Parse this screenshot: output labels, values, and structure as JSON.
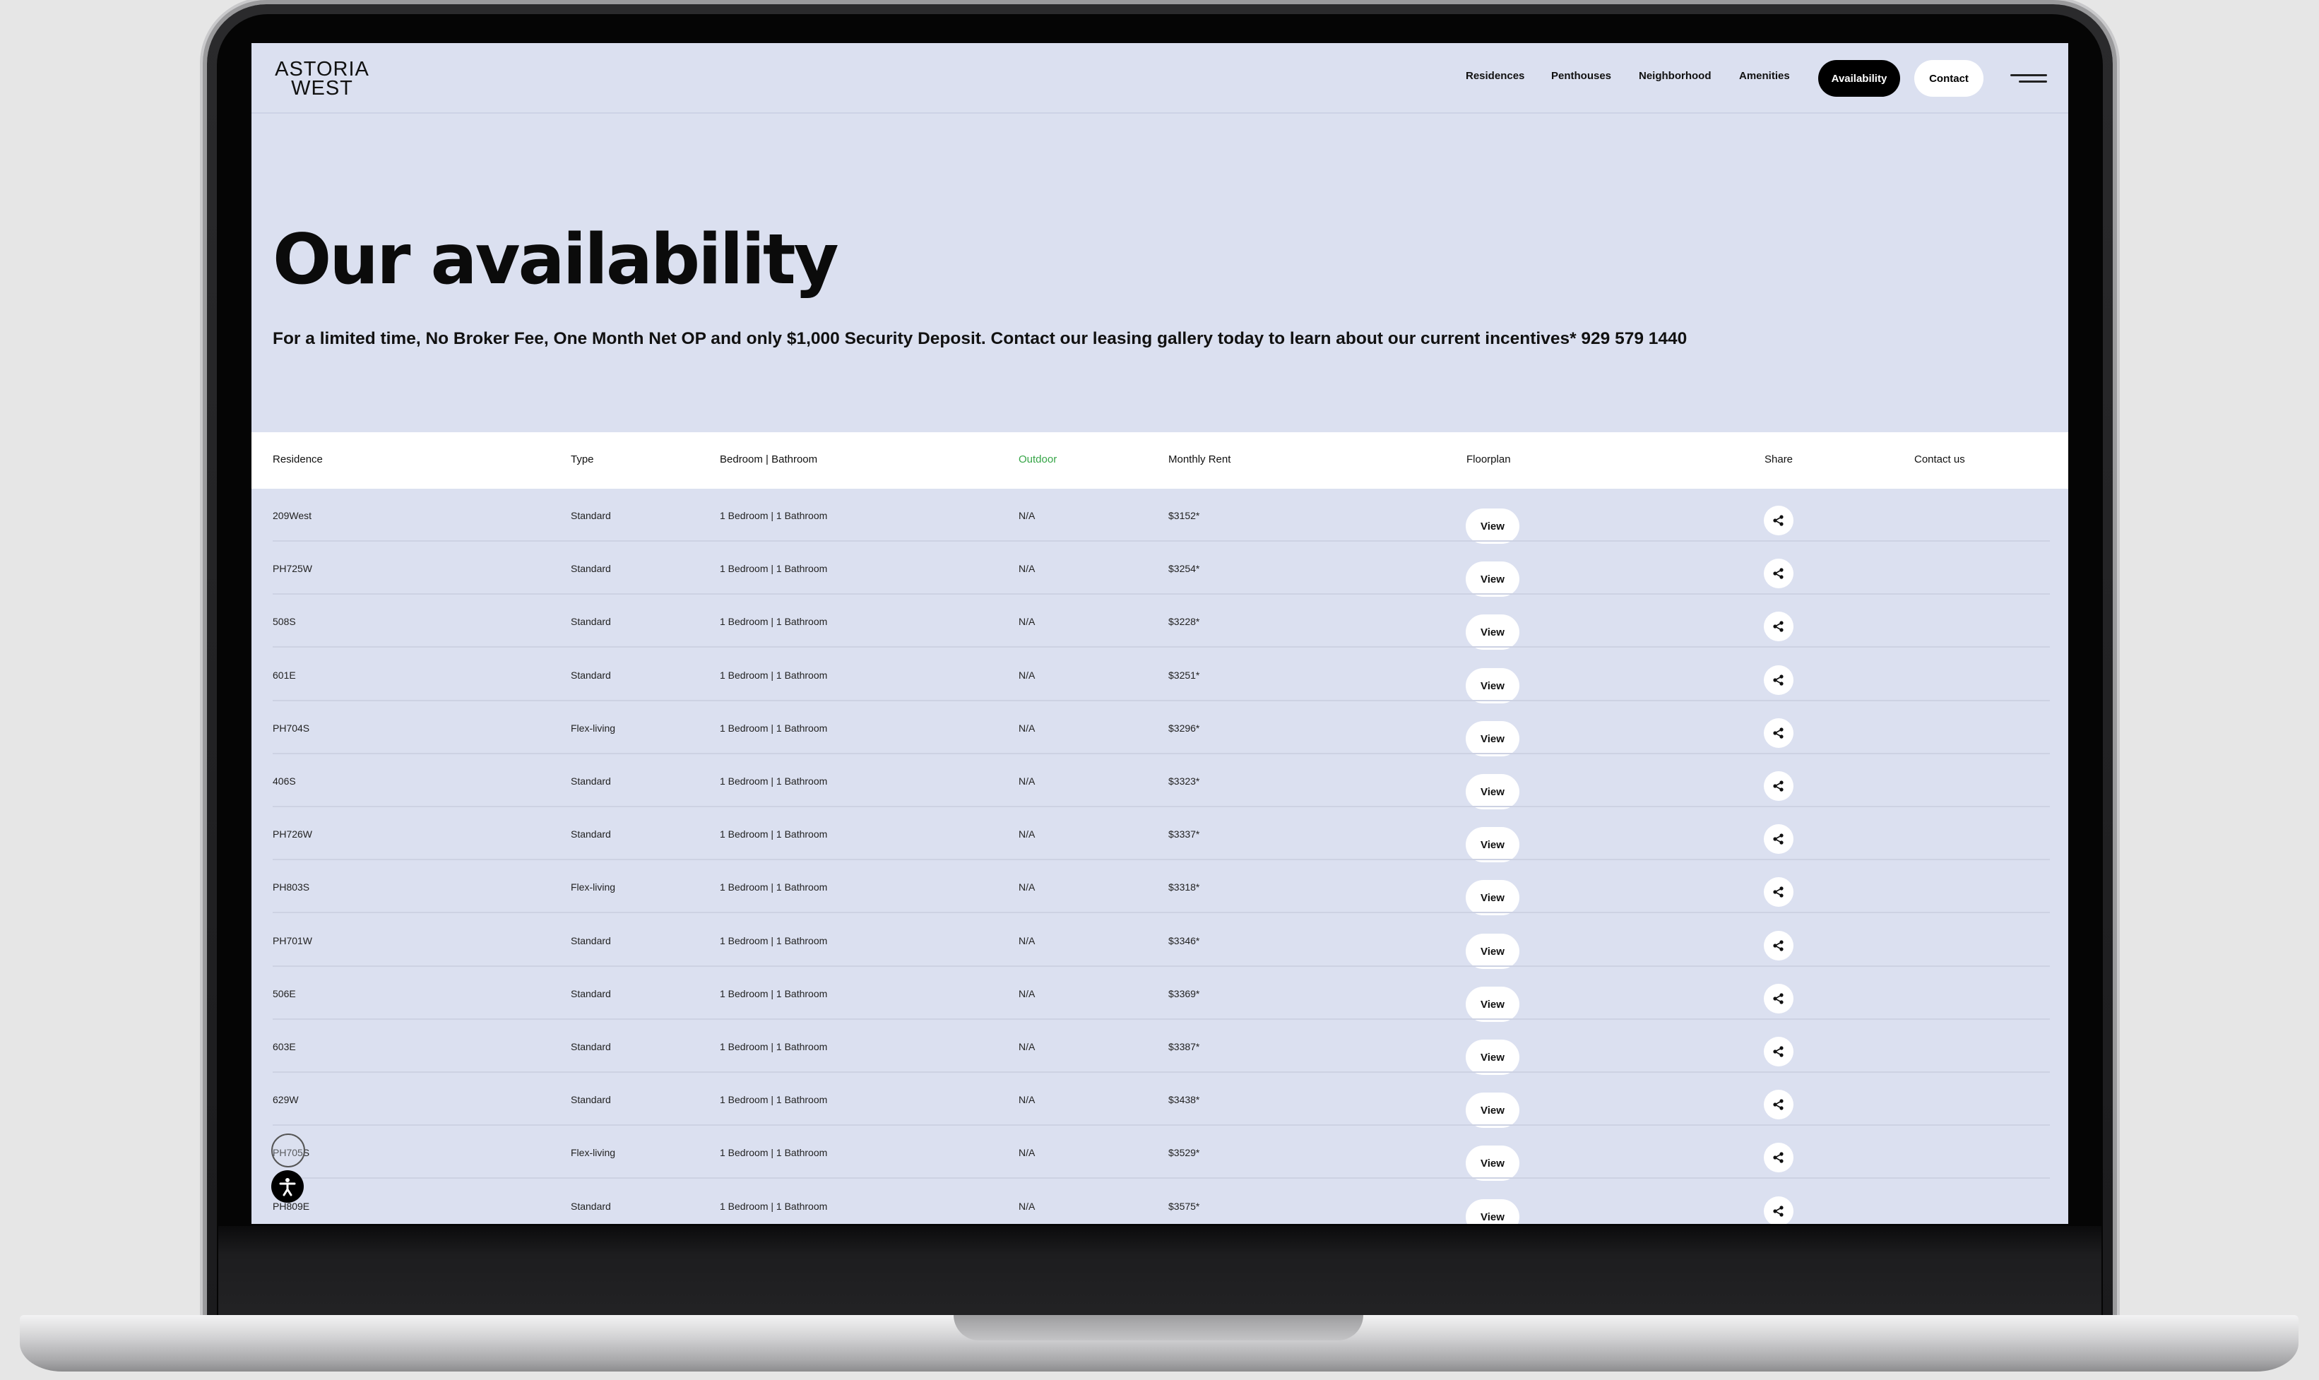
{
  "logo": {
    "line1": "ASTORIA",
    "line2": "WEST"
  },
  "nav": {
    "links": [
      "Residences",
      "Penthouses",
      "Neighborhood",
      "Amenities"
    ],
    "availability_label": "Availability",
    "contact_label": "Contact"
  },
  "hero": {
    "title": "Our availability",
    "promo": "For a limited time, No Broker Fee, One Month Net OP and only $1,000 Security Deposit. Contact our leasing gallery today to learn about our current incentives* 929 579 1440"
  },
  "table": {
    "headers": [
      "Residence",
      "Type",
      "Bedroom | Bathroom",
      "Outdoor",
      "Monthly Rent",
      "Floorplan",
      "Share",
      "Contact us"
    ],
    "view_label": "View",
    "rows": [
      {
        "residence": "209West",
        "type": "Standard",
        "bedbath": "1 Bedroom | 1 Bathroom",
        "outdoor": "N/A",
        "rent": "$3152*"
      },
      {
        "residence": "PH725W",
        "type": "Standard",
        "bedbath": "1 Bedroom | 1 Bathroom",
        "outdoor": "N/A",
        "rent": "$3254*"
      },
      {
        "residence": "508S",
        "type": "Standard",
        "bedbath": "1 Bedroom | 1 Bathroom",
        "outdoor": "N/A",
        "rent": "$3228*"
      },
      {
        "residence": "601E",
        "type": "Standard",
        "bedbath": "1 Bedroom | 1 Bathroom",
        "outdoor": "N/A",
        "rent": "$3251*"
      },
      {
        "residence": "PH704S",
        "type": "Flex-living",
        "bedbath": "1 Bedroom | 1 Bathroom",
        "outdoor": "N/A",
        "rent": "$3296*"
      },
      {
        "residence": "406S",
        "type": "Standard",
        "bedbath": "1 Bedroom | 1 Bathroom",
        "outdoor": "N/A",
        "rent": "$3323*"
      },
      {
        "residence": "PH726W",
        "type": "Standard",
        "bedbath": "1 Bedroom | 1 Bathroom",
        "outdoor": "N/A",
        "rent": "$3337*"
      },
      {
        "residence": "PH803S",
        "type": "Flex-living",
        "bedbath": "1 Bedroom | 1 Bathroom",
        "outdoor": "N/A",
        "rent": "$3318*"
      },
      {
        "residence": "PH701W",
        "type": "Standard",
        "bedbath": "1 Bedroom | 1 Bathroom",
        "outdoor": "N/A",
        "rent": "$3346*"
      },
      {
        "residence": "506E",
        "type": "Standard",
        "bedbath": "1 Bedroom | 1 Bathroom",
        "outdoor": "N/A",
        "rent": "$3369*"
      },
      {
        "residence": "603E",
        "type": "Standard",
        "bedbath": "1 Bedroom | 1 Bathroom",
        "outdoor": "N/A",
        "rent": "$3387*"
      },
      {
        "residence": "629W",
        "type": "Standard",
        "bedbath": "1 Bedroom | 1 Bathroom",
        "outdoor": "N/A",
        "rent": "$3438*"
      },
      {
        "residence": "PH705S",
        "type": "Flex-living",
        "bedbath": "1 Bedroom | 1 Bathroom",
        "outdoor": "N/A",
        "rent": "$3529*"
      },
      {
        "residence": "PH809E",
        "type": "Standard",
        "bedbath": "1 Bedroom | 1 Bathroom",
        "outdoor": "N/A",
        "rent": "$3575*"
      }
    ]
  },
  "colors": {
    "page_background": "#dbe0f0",
    "outdoor_header": "#36a547",
    "primary_button": "#000000"
  },
  "icons": [
    "share-icon",
    "hamburger-menu-icon",
    "accessibility-icon"
  ]
}
